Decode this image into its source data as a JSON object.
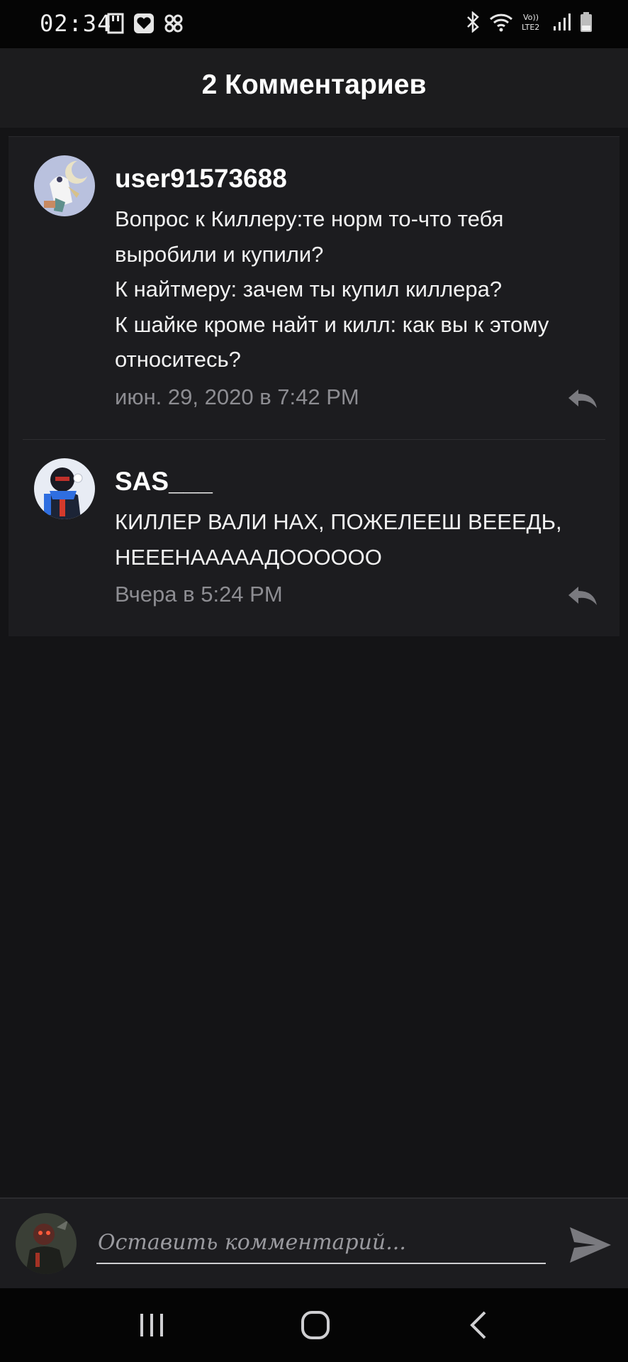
{
  "status_bar": {
    "time": "02:34",
    "network_label": "Vo))\nLTE2"
  },
  "header": {
    "title": "2 Комментариев"
  },
  "comments": [
    {
      "username": "user91573688",
      "lines": [
        "Вопрос к Киллеру:те норм то-что тебя",
        "выробили  и купили?",
        "К найтмеру: зачем ты купил киллера?",
        "К шайке кроме найт и килл: как вы к этому",
        "относитесь?"
      ],
      "timestamp": "июн. 29, 2020 в 7:42 PM"
    },
    {
      "username": "SAS___",
      "lines": [
        "КИЛЛЕР ВАЛИ НАХ, ПОЖЕЛЕЕШ ВЕЕЕДЬ,",
        "НЕЕЕНАААААДООООOО"
      ],
      "timestamp": "Вчера в 5:24 PM"
    }
  ],
  "comment_input": {
    "placeholder": "Оставить комментарий..."
  },
  "colors": {
    "background": "#141416",
    "panel": "#1c1c1f",
    "timestamp": "#8d8d92",
    "icon_gray": "#7a7a7f"
  },
  "icons": [
    "reply-icon",
    "send-icon",
    "recent-apps-icon",
    "home-icon",
    "back-icon",
    "bluetooth-icon",
    "wifi-icon",
    "signal-icon",
    "battery-icon"
  ]
}
